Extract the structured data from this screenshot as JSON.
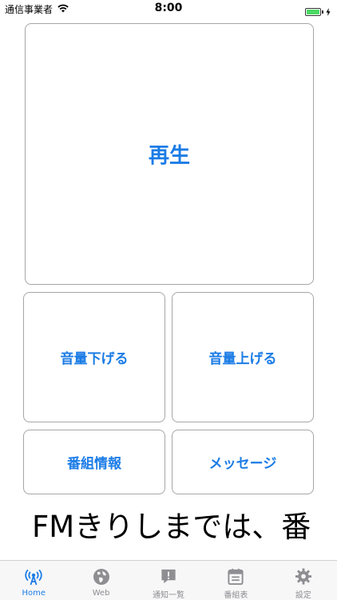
{
  "status_bar": {
    "carrier": "通信事業者",
    "time": "8:00",
    "battery_level": 1.0
  },
  "buttons": {
    "play": "再生",
    "volume_down": "音量下げる",
    "volume_up": "音量上げる",
    "program_info": "番組情報",
    "message": "メッセージ"
  },
  "ticker": {
    "text": "FMきりしまでは、番"
  },
  "tabs": [
    {
      "label": "Home",
      "icon": "antenna-icon",
      "active": true
    },
    {
      "label": "Web",
      "icon": "globe-icon",
      "active": false
    },
    {
      "label": "通知一覧",
      "icon": "notification-icon",
      "active": false
    },
    {
      "label": "番組表",
      "icon": "calendar-icon",
      "active": false
    },
    {
      "label": "設定",
      "icon": "gear-icon",
      "active": false
    }
  ],
  "colors": {
    "accent": "#1b7ce6",
    "inactive": "#8e8e93",
    "border": "#a6a6a6",
    "battery": "#4cd964"
  }
}
